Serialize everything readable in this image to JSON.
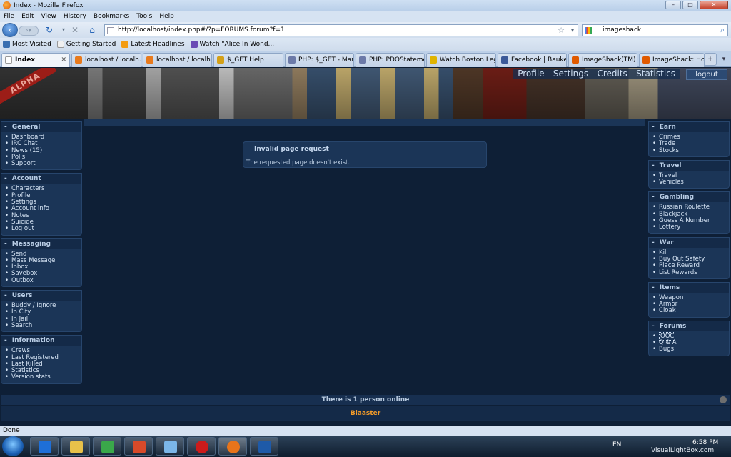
{
  "window": {
    "title": "Index - Mozilla Firefox",
    "controls": [
      "–",
      "□",
      "✕"
    ]
  },
  "menu": [
    "File",
    "Edit",
    "View",
    "History",
    "Bookmarks",
    "Tools",
    "Help"
  ],
  "navbar": {
    "url": "http://localhost/index.php#/?p=FORUMS.forum?f=1",
    "search_value": "imageshack"
  },
  "bookmarks": [
    {
      "label": "Most Visited",
      "icon": "gear-icon",
      "color": "#3a6fb0"
    },
    {
      "label": "Getting Started",
      "icon": "page-icon",
      "color": "#f0f0f0"
    },
    {
      "label": "Latest Headlines",
      "icon": "rss-icon",
      "color": "#f39c12"
    },
    {
      "label": "Watch \"Alice In Wond...",
      "icon": "video-icon",
      "color": "#6a4bb5"
    }
  ],
  "tabs": [
    {
      "label": "Index",
      "active": true,
      "color": "#ffffff"
    },
    {
      "label": "localhost / localh...",
      "active": false,
      "color": "#e87a1d"
    },
    {
      "label": "localhost / localh...",
      "active": false,
      "color": "#e87a1d"
    },
    {
      "label": "$_GET Help",
      "active": false,
      "color": "#d4a017"
    },
    {
      "label": "PHP: $_GET - Man...",
      "active": false,
      "color": "#6c7aa8"
    },
    {
      "label": "PHP: PDOStateme...",
      "active": false,
      "color": "#6c7aa8"
    },
    {
      "label": "Watch Boston Leg...",
      "active": false,
      "color": "#e0b400"
    },
    {
      "label": "Facebook | Bauke ...",
      "active": false,
      "color": "#3b5998"
    },
    {
      "label": "ImageShack(TM) ...",
      "active": false,
      "color": "#e05a00"
    },
    {
      "label": "ImageShack: Host...",
      "active": false,
      "color": "#e05a00"
    }
  ],
  "header": {
    "banner_tag": "ALPHA",
    "nav": [
      "Profile",
      "Settings",
      "Credits",
      "Statistics"
    ],
    "nav_separator": "-",
    "logout": "logout"
  },
  "left_panels": [
    {
      "title": "General",
      "items": [
        "Dashboard",
        "IRC Chat",
        "News (15)",
        "Polls",
        "Support"
      ]
    },
    {
      "title": "Account",
      "items": [
        "Characters",
        "Profile",
        "Settings",
        "Account info",
        "Notes",
        "Suicide",
        "Log out"
      ]
    },
    {
      "title": "Messaging",
      "items": [
        "Send",
        "Mass Message",
        "Inbox",
        "Savebox",
        "Outbox"
      ]
    },
    {
      "title": "Users",
      "items": [
        "Buddy / Ignore",
        "In City",
        "In Jail",
        "Search"
      ]
    },
    {
      "title": "Information",
      "items": [
        "Crews",
        "Last Registered",
        "Last Killed",
        "Statistics",
        "Version stats"
      ]
    }
  ],
  "right_panels": [
    {
      "title": "Earn",
      "items": [
        "Crimes",
        "Trade",
        "Stocks"
      ]
    },
    {
      "title": "Travel",
      "items": [
        "Travel",
        "Vehicles"
      ]
    },
    {
      "title": "Gambling",
      "items": [
        "Russian Roulette",
        "Blackjack",
        "Guess A Number",
        "Lottery"
      ]
    },
    {
      "title": "War",
      "items": [
        "Kill",
        "Buy Out Safety",
        "Place Reward",
        "List Rewards"
      ]
    },
    {
      "title": "Items",
      "items": [
        "Weapon",
        "Armor",
        "Cloak"
      ]
    },
    {
      "title": "Forums",
      "items": [
        "OOC",
        "Q & A",
        "Bugs"
      ]
    }
  ],
  "notice": {
    "title": "Invalid page request",
    "body": "The requested page doesn't exist."
  },
  "footer": {
    "online": "There is 1 person online",
    "user": "Blaaster"
  },
  "statusbar": "Done",
  "taskbar": {
    "apps": [
      {
        "icon": "ie-icon",
        "color": "#1e6fd8"
      },
      {
        "icon": "explorer-icon",
        "color": "#e8c14a"
      },
      {
        "icon": "messenger-icon",
        "color": "#3aa84a"
      },
      {
        "icon": "media-icon",
        "color": "#d84a2a"
      },
      {
        "icon": "notepad-icon",
        "color": "#7bb6e8"
      },
      {
        "icon": "opera-icon",
        "color": "#cc1b1b"
      },
      {
        "icon": "firefox-icon",
        "color": "#e8741a"
      },
      {
        "icon": "photoshop-icon",
        "color": "#1e5aa8"
      }
    ],
    "lang": "EN",
    "time": "6:58 PM",
    "watermark": "VisualLightBox.com"
  }
}
